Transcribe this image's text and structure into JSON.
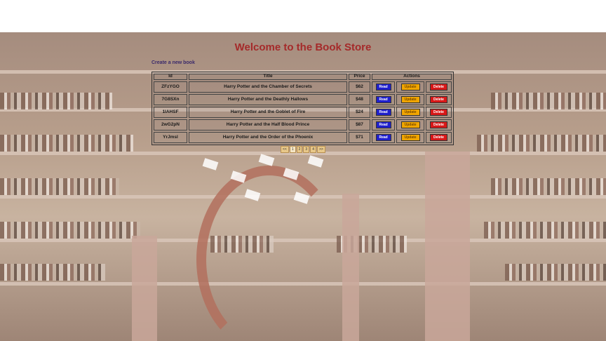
{
  "header": {
    "title": "Welcome to the Book Store"
  },
  "actions": {
    "create_link": "Create a new book"
  },
  "table": {
    "columns": [
      "Id",
      "Title",
      "Price",
      "Actions"
    ],
    "buttons": {
      "read": "Read",
      "update": "Update",
      "delete": "Delete"
    },
    "rows": [
      {
        "id": "ZFzYGO",
        "title": "Harry Potter and the Chamber of Secrets",
        "price": "$62"
      },
      {
        "id": "7G8SXn",
        "title": "Harry Potter and the Deathly Hallows",
        "price": "$48"
      },
      {
        "id": "1IAHSF",
        "title": "Harry Potter and the Goblet of Fire",
        "price": "$24"
      },
      {
        "id": "2wG2pN",
        "title": "Harry Potter and the Half Blood Prince",
        "price": "$87"
      },
      {
        "id": "YrJmsl",
        "title": "Harry Potter and the Order of the Phoenix",
        "price": "$71"
      }
    ]
  },
  "pagination": {
    "prev": "<<",
    "pages": [
      "1",
      "2",
      "3",
      "4"
    ],
    "next": ">>",
    "current": "1"
  },
  "colors": {
    "title": "#a52a2a",
    "read": "#1f1fcc",
    "update": "#f0a500",
    "delete": "#d81818"
  }
}
